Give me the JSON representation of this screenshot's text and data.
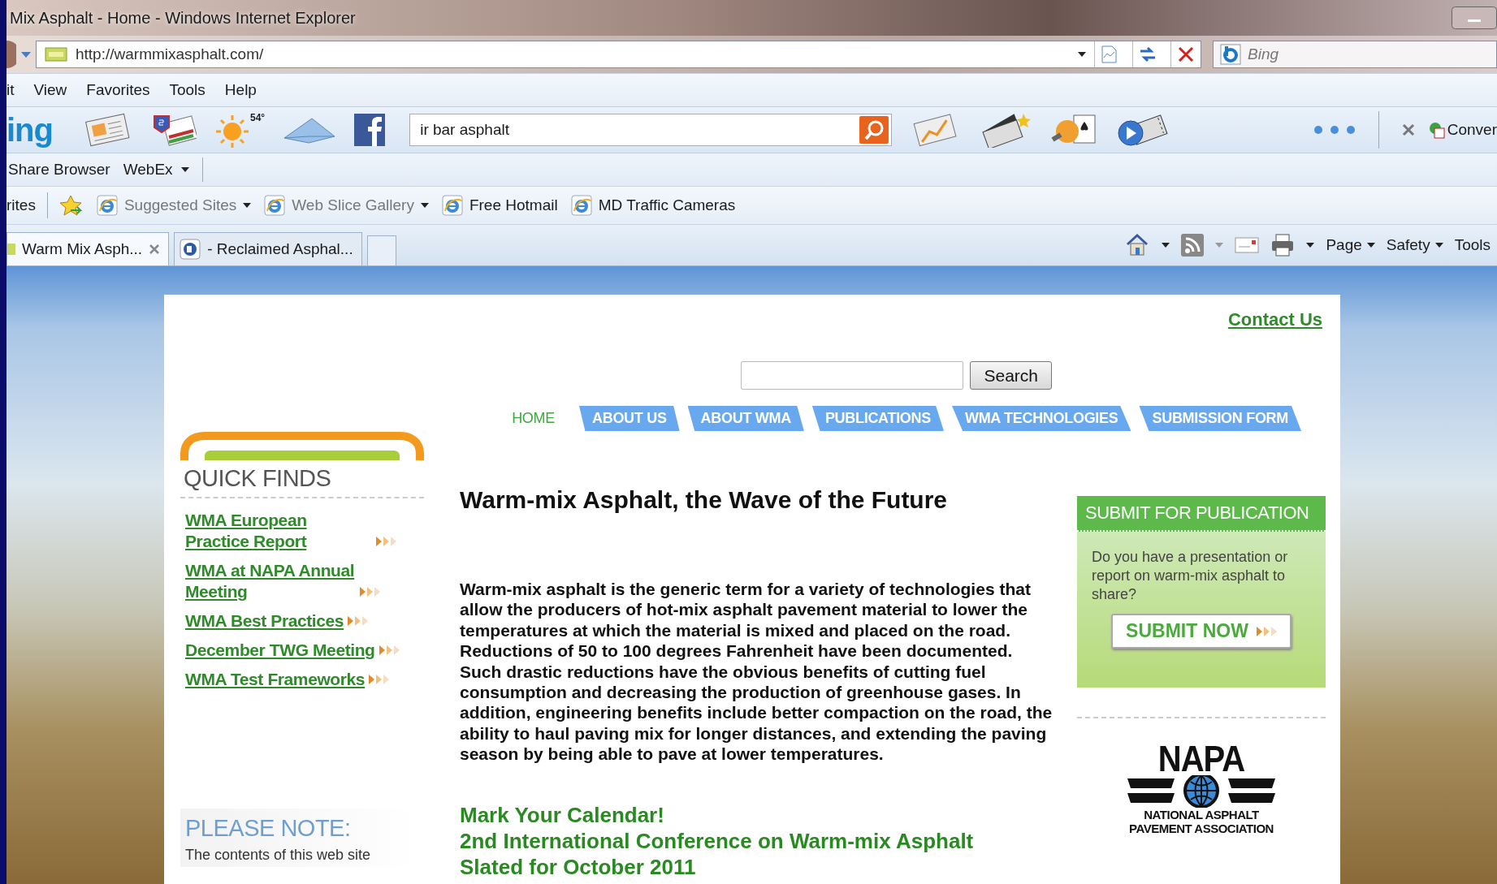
{
  "window": {
    "title": "Mix Asphalt - Home - Windows Internet Explorer"
  },
  "address_bar": {
    "url": "http://warmmixasphalt.com/",
    "search_placeholder": "Bing"
  },
  "menu": [
    "it",
    "View",
    "Favorites",
    "Tools",
    "Help"
  ],
  "bing_bar": {
    "logo": "ing",
    "weather": "54°",
    "search_value": "ir bar asphalt",
    "button": "Conver"
  },
  "links_bar": [
    {
      "label": "Share Browser",
      "dropdown": false
    },
    {
      "label": "WebEx",
      "dropdown": true
    }
  ],
  "favorites_bar": {
    "label": "rites",
    "items": [
      {
        "label": "Suggested Sites",
        "dropdown": true,
        "dimmed": true
      },
      {
        "label": "Web Slice Gallery",
        "dropdown": true,
        "dimmed": true
      },
      {
        "label": "Free Hotmail",
        "dropdown": false,
        "dimmed": false
      },
      {
        "label": "MD Traffic Cameras",
        "dropdown": false,
        "dimmed": false
      }
    ]
  },
  "tabs": [
    {
      "label": "Warm Mix Asph...",
      "selected": true
    },
    {
      "label": "- Reclaimed Asphal...",
      "selected": false
    }
  ],
  "command_bar": [
    "Page",
    "Safety",
    "Tools"
  ],
  "site": {
    "contact": "Contact Us",
    "search_button": "Search",
    "nav": [
      {
        "label": "HOME",
        "selected": true
      },
      {
        "label": "ABOUT US",
        "selected": false
      },
      {
        "label": "ABOUT WMA",
        "selected": false
      },
      {
        "label": "PUBLICATIONS",
        "selected": false
      },
      {
        "label": "WMA TECHNOLOGIES",
        "selected": false
      },
      {
        "label": "SUBMISSION FORM",
        "selected": false
      }
    ],
    "quick_finds": {
      "title": "QUICK FINDS",
      "links": [
        "WMA European Practice Report",
        "WMA at NAPA Annual Meeting",
        "WMA Best Practices",
        "December TWG Meeting",
        "WMA Test Frameworks"
      ]
    },
    "note": {
      "title": "PLEASE NOTE:",
      "text": "The contents of this web site"
    },
    "article": {
      "title": "Warm-mix Asphalt, the Wave of the Future",
      "body": "Warm-mix asphalt is the generic term for a variety of technologies that allow the producers of hot-mix asphalt pavement material to lower the temperatures at which the material is mixed and placed on the road. Reductions of 50 to 100 degrees Fahrenheit have been documented. Such drastic reductions have the obvious benefits of cutting fuel consumption and decreasing the production of greenhouse gases. In addition, engineering benefits include better compaction on the road, the ability to haul paving mix for longer distances, and extending the paving season by being able to pave at lower temperatures.",
      "calendar": [
        "Mark Your Calendar!",
        "2nd International Conference on Warm-mix Asphalt",
        "Slated for October 2011"
      ]
    },
    "submit_box": {
      "title": "SUBMIT FOR PUBLICATION",
      "text": "Do you have a presentation or report on warm-mix asphalt to share?",
      "button": "SUBMIT NOW"
    },
    "napa_logo": {
      "acronym": "NAPA",
      "name_lines": [
        "NATIONAL ASPHALT",
        "PAVEMENT ASSOCIATION"
      ]
    }
  }
}
